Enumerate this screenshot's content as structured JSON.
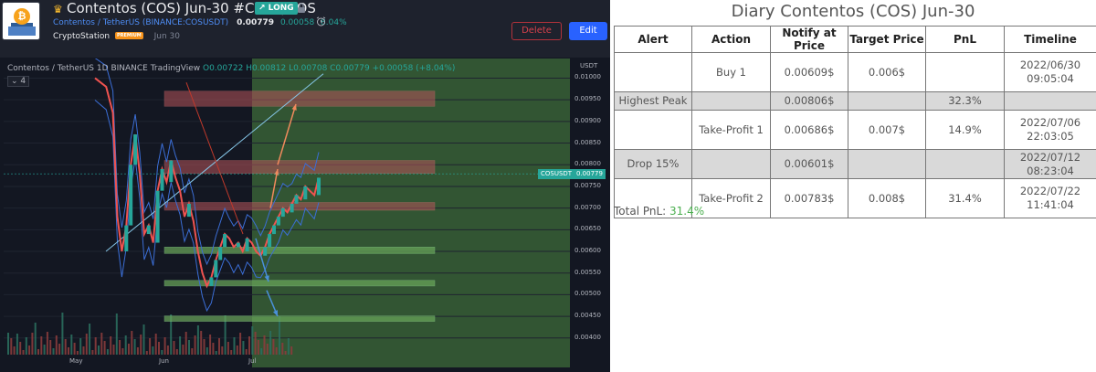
{
  "header": {
    "title": "Contentos (COS) Jun-30 #COS $COS",
    "badge": "↗ LONG",
    "pair_name": "Contentos / TetherUS",
    "exchange_symbol": "(BINANCE:COSUSDT)",
    "price": "0.00779",
    "change": "0.00058",
    "change_pct": "8.04%",
    "author": "CryptoStation",
    "author_badge": "PREMIUM",
    "date": "Jun 30",
    "delete_label": "Delete",
    "edit_label": "Edit"
  },
  "chart": {
    "symbol_line": "Contentos / TetherUS",
    "interval": "1D",
    "exchange": "BINANCE",
    "provider": "TradingView",
    "open": "O0.00722",
    "high": "H0.00812",
    "low": "L0.00708",
    "close": "C0.00779",
    "delta": "+0.00058 (+8.04%)",
    "indicator_count": "⌄ 4",
    "axis_unit": "USDT",
    "current_symbol": "COSUSDT",
    "current_price": "0.00779"
  },
  "chart_data": {
    "type": "line",
    "title": "Contentos / TetherUS 1D BINANCE",
    "ylabel": "USDT",
    "ylim": [
      0.0037,
      0.0102
    ],
    "y_ticks": [
      "0.01000",
      "0.00950",
      "0.00900",
      "0.00850",
      "0.00800",
      "0.00750",
      "0.00700",
      "0.00650",
      "0.00600",
      "0.00550",
      "0.00500",
      "0.00450",
      "0.00400"
    ],
    "x_ticks": [
      "May",
      "Jun",
      "Jul"
    ],
    "series": [
      {
        "x": [
          0,
          5,
          8,
          10,
          12,
          14,
          16,
          18,
          20,
          22,
          24,
          26,
          28,
          30,
          32,
          34,
          36,
          38,
          40,
          42,
          44,
          46,
          48,
          50,
          52,
          54,
          56,
          58,
          60,
          62,
          64,
          66,
          68,
          70,
          72,
          74,
          76,
          78,
          80,
          82,
          84,
          86,
          88,
          90,
          92,
          94,
          96,
          98,
          100
        ],
        "values": [
          0.01,
          0.0098,
          0.0092,
          0.0068,
          0.006,
          0.0066,
          0.008,
          0.0087,
          0.0078,
          0.0064,
          0.0066,
          0.0062,
          0.0074,
          0.0079,
          0.0076,
          0.0081,
          0.0077,
          0.0074,
          0.0068,
          0.0071,
          0.0067,
          0.006,
          0.0055,
          0.0052,
          0.0054,
          0.0058,
          0.0061,
          0.0064,
          0.0063,
          0.0061,
          0.0062,
          0.006,
          0.0063,
          0.0062,
          0.006,
          0.0059,
          0.0061,
          0.0064,
          0.0066,
          0.0068,
          0.007,
          0.0069,
          0.0071,
          0.0073,
          0.0072,
          0.0075,
          0.0074,
          0.0073,
          0.0077
        ]
      }
    ],
    "zones": [
      {
        "type": "resistance",
        "from": 0.00935,
        "to": 0.0097
      },
      {
        "type": "resistance",
        "from": 0.0078,
        "to": 0.0081
      },
      {
        "type": "resistance",
        "from": 0.00695,
        "to": 0.00713
      },
      {
        "type": "support",
        "from": 0.00595,
        "to": 0.0061
      },
      {
        "type": "support",
        "from": 0.0052,
        "to": 0.00533
      },
      {
        "type": "support",
        "from": 0.0044,
        "to": 0.00451
      }
    ],
    "current_price": 0.00779
  },
  "diary": {
    "title": "Diary Contentos (COS) Jun-30",
    "columns": [
      "Alert",
      "Action",
      "Notify at Price",
      "Target Price",
      "PnL",
      "Timeline"
    ],
    "rows": [
      {
        "alert": "",
        "action": "Buy 1",
        "notify": "0.00609$",
        "target": "0.006$",
        "pnl": "",
        "date": "2022/06/30",
        "time": "09:05:04",
        "gray": false
      },
      {
        "alert": "Highest Peak",
        "action": "",
        "notify": "0.00806$",
        "target": "",
        "pnl": "32.3%",
        "date": "",
        "time": "",
        "gray": true
      },
      {
        "alert": "",
        "action": "Take-Profit 1",
        "notify": "0.00686$",
        "target": "0.007$",
        "pnl": "14.9%",
        "date": "2022/07/06",
        "time": "22:03:05",
        "gray": false
      },
      {
        "alert": "Drop 15%",
        "action": "",
        "notify": "0.00601$",
        "target": "",
        "pnl": "",
        "date": "2022/07/12",
        "time": "08:23:04",
        "gray": true
      },
      {
        "alert": "",
        "action": "Take-Profit 2",
        "notify": "0.00783$",
        "target": "0.008$",
        "pnl": "31.4%",
        "date": "2022/07/22",
        "time": "11:41:04",
        "gray": false
      }
    ],
    "total_label": "Total PnL:",
    "total_value": "31.4%"
  },
  "colors": {
    "bg_dark": "#131722",
    "up": "#26a69a",
    "down": "#ef5350",
    "accent": "#2962ff",
    "pnl_green": "#4caf50"
  }
}
